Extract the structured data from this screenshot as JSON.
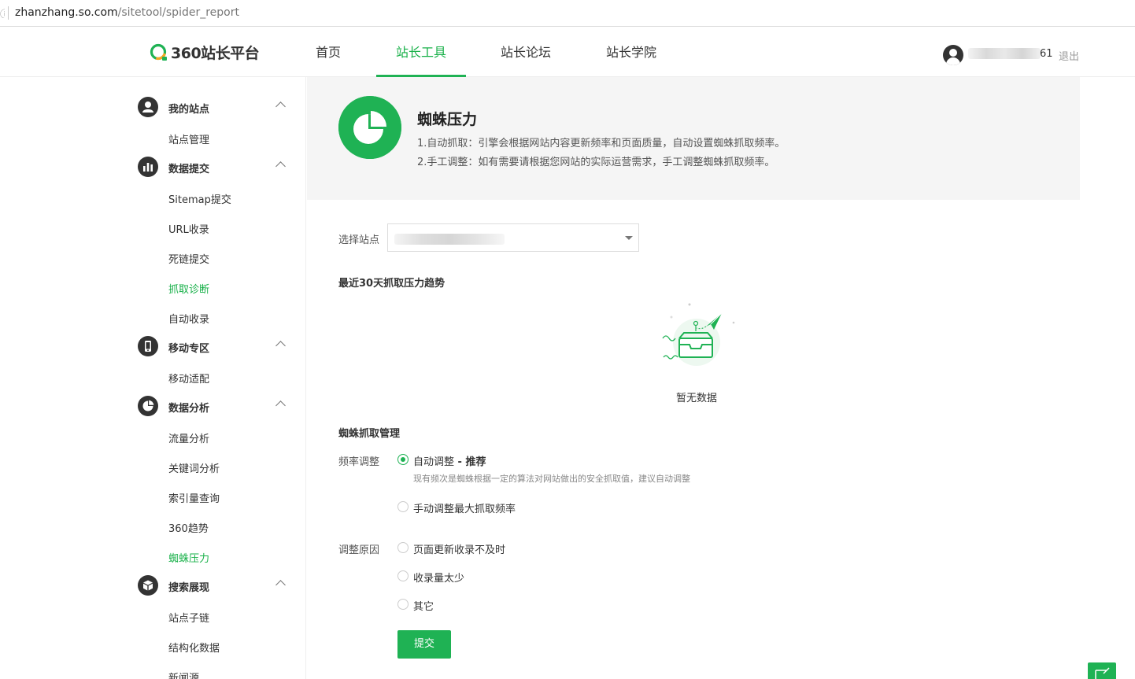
{
  "browser": {
    "url_host": "zhanzhang.so.com",
    "url_path": "/sitetool/spider_report"
  },
  "header": {
    "logo_text": "360站长平台",
    "nav": [
      {
        "label": "首页"
      },
      {
        "label": "站长工具",
        "active": true
      },
      {
        "label": "站长论坛"
      },
      {
        "label": "站长学院"
      }
    ],
    "user_suffix": "61",
    "logout_label": "退出"
  },
  "sidebar": {
    "sections": [
      {
        "label": "我的站点",
        "icon": "user-icon",
        "items": [
          "站点管理"
        ]
      },
      {
        "label": "数据提交",
        "icon": "bar-chart-icon",
        "items": [
          "Sitemap提交",
          "URL收录",
          "死链提交",
          "抓取诊断",
          "自动收录"
        ]
      },
      {
        "label": "移动专区",
        "icon": "mobile-icon",
        "items": [
          "移动适配"
        ]
      },
      {
        "label": "数据分析",
        "icon": "pie-chart-icon",
        "items": [
          "流量分析",
          "关键词分析",
          "索引量查询",
          "360趋势",
          "蜘蛛压力"
        ]
      },
      {
        "label": "搜索展现",
        "icon": "cube-icon",
        "items": [
          "站点子链",
          "结构化数据",
          "新闻源"
        ]
      }
    ],
    "highlighted": [
      "抓取诊断",
      "蜘蛛压力"
    ]
  },
  "banner": {
    "icon": "pie-chart-icon",
    "title": "蜘蛛压力",
    "desc1": "1.自动抓取：引擎会根据网站内容更新频率和页面质量，自动设置蜘蛛抓取频率。",
    "desc2": "2.手工调整：如有需要请根据您网站的实际运营需求，手工调整蜘蛛抓取频率。"
  },
  "site_select": {
    "label": "选择站点"
  },
  "trend": {
    "title": "最近30天抓取压力趋势",
    "empty_text": "暂无数据"
  },
  "manage": {
    "title": "蜘蛛抓取管理",
    "freq_label": "频率调整",
    "freq_auto": "自动调整",
    "freq_auto_tag": " - 推荐",
    "freq_auto_hint": "现有频次是蜘蛛根据一定的算法对网站做出的安全抓取值，建议自动调整",
    "freq_manual": "手动调整最大抓取频率",
    "reason_label": "调整原因",
    "reasons": [
      "页面更新收录不及时",
      "收录量太少",
      "其它"
    ],
    "submit_label": "提交"
  },
  "colors": {
    "accent": "#1fb254",
    "text": "#333333",
    "banner_bg": "#f5f5f5"
  }
}
